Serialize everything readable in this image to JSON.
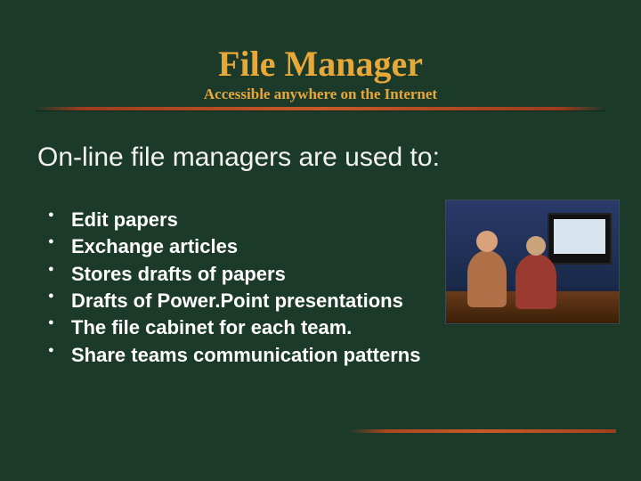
{
  "title": "File Manager",
  "subtitle": "Accessible anywhere on the Internet",
  "heading": "On-line file managers are used to:",
  "bullets": [
    "Edit papers",
    "Exchange articles",
    "Stores drafts of papers",
    "Drafts of Power.Point presentations",
    "The file cabinet for each team.",
    "Share teams communication patterns"
  ]
}
